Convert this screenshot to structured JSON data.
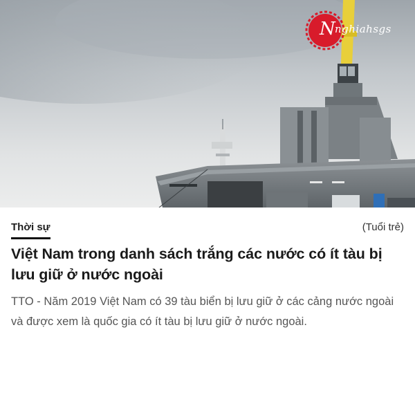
{
  "hero": {
    "image_name": "cargo-ship-photo",
    "logo": {
      "icon": "seal-icon",
      "initial": "N",
      "text": "nghiahsgs"
    }
  },
  "article": {
    "category": "Thời sự",
    "source": "(Tuổi trẻ)",
    "title": "Việt Nam trong danh sách trắng các nước có ít tàu bị lưu giữ ở nước ngoài",
    "summary": "TTO - Năm 2019 Việt Nam có 39 tàu biển bị lưu giữ ở các cảng nước ngoài và được xem là quốc gia có ít tàu bị lưu giữ ở nước ngoài."
  },
  "colors": {
    "logo_red": "#d81b2b",
    "category_underline": "#111111",
    "sky": "#d9dcde",
    "hull": "#7d8286",
    "crane_yellow": "#e8cf3a"
  }
}
